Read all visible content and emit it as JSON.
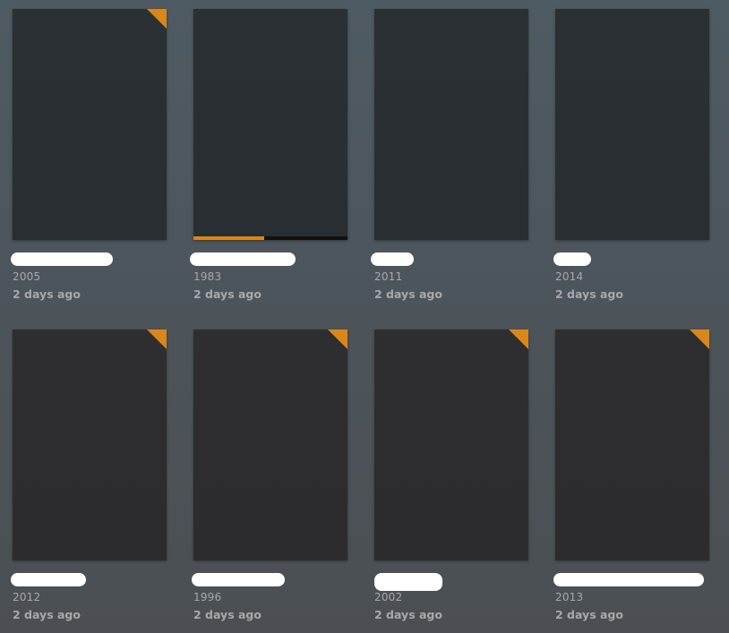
{
  "accent_color": "#d9861a",
  "items": [
    {
      "year": "2005",
      "added": "2 days ago",
      "unwatched": true,
      "progress": null
    },
    {
      "year": "1983",
      "added": "2 days ago",
      "unwatched": false,
      "progress": 0.46
    },
    {
      "year": "2011",
      "added": "2 days ago",
      "unwatched": false,
      "progress": null
    },
    {
      "year": "2014",
      "added": "2 days ago",
      "unwatched": false,
      "progress": null
    },
    {
      "year": "2012",
      "added": "2 days ago",
      "unwatched": true,
      "progress": null
    },
    {
      "year": "1996",
      "added": "2 days ago",
      "unwatched": true,
      "progress": null
    },
    {
      "year": "2002",
      "added": "2 days ago",
      "unwatched": true,
      "progress": null
    },
    {
      "year": "2013",
      "added": "2 days ago",
      "unwatched": true,
      "progress": null
    }
  ]
}
